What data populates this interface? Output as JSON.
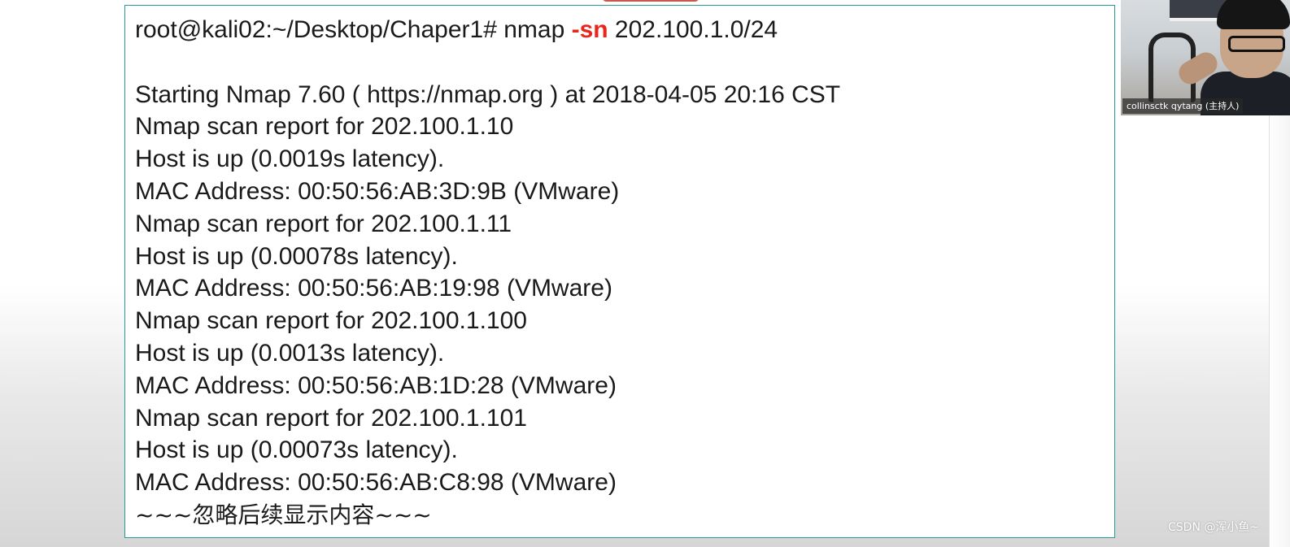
{
  "terminal": {
    "prompt": "root@kali02:~/Desktop/Chaper1# nmap ",
    "flag": "-sn",
    "target": " 202.100.1.0/24",
    "lines": [
      "Starting Nmap 7.60 ( https://nmap.org ) at 2018-04-05 20:16 CST",
      "Nmap scan report for 202.100.1.10",
      "Host is up (0.0019s latency).",
      "MAC Address: 00:50:56:AB:3D:9B (VMware)",
      "Nmap scan report for 202.100.1.11",
      "Host is up (0.00078s latency).",
      "MAC Address: 00:50:56:AB:19:98 (VMware)",
      "Nmap scan report for 202.100.1.100",
      "Host is up (0.0013s latency).",
      "MAC Address: 00:50:56:AB:1D:28 (VMware)",
      "Nmap scan report for 202.100.1.101",
      "Host is up (0.00073s latency).",
      "MAC Address: 00:50:56:AB:C8:98 (VMware)"
    ],
    "footer": "~~~忽略后续显示内容~~~"
  },
  "webcam": {
    "participant_label": "collinsctk qytang (主持人)"
  },
  "watermark": "CSDN @浑小鱼~",
  "colors": {
    "flag": "#e8261c",
    "border": "#2a9a96"
  }
}
